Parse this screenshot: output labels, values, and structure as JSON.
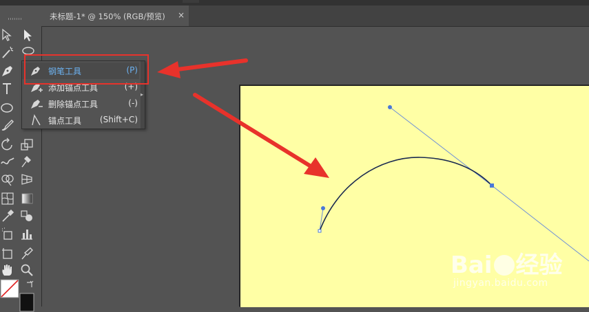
{
  "document_tab": {
    "title": "未标题-1* @ 150% (RGB/预览)",
    "close_glyph": "×"
  },
  "toolbar": {
    "tools": [
      {
        "name": "selection-tool-icon"
      },
      {
        "name": "direct-selection-tool-icon"
      },
      {
        "name": "magic-wand-tool-icon"
      },
      {
        "name": "lasso-tool-icon"
      },
      {
        "name": "pen-tool-icon"
      },
      {
        "name": "type-tool-icon"
      },
      {
        "name": "ellipse-tool-icon"
      },
      {
        "name": "paintbrush-tool-icon"
      },
      {
        "name": "rotate-tool-icon"
      },
      {
        "name": "scale-tool-icon"
      },
      {
        "name": "warp-tool-icon"
      },
      {
        "name": "puppet-warp-tool-icon"
      },
      {
        "name": "shape-builder-tool-icon"
      },
      {
        "name": "perspective-grid-tool-icon"
      },
      {
        "name": "mesh-tool-icon"
      },
      {
        "name": "gradient-tool-icon"
      },
      {
        "name": "eyedropper-tool-icon"
      },
      {
        "name": "blend-tool-icon"
      },
      {
        "name": "symbol-sprayer-tool-icon"
      },
      {
        "name": "column-graph-tool-icon"
      },
      {
        "name": "artboard-tool-icon"
      },
      {
        "name": "slice-tool-icon"
      },
      {
        "name": "hand-tool-icon"
      },
      {
        "name": "zoom-tool-icon"
      }
    ]
  },
  "pen_flyout": {
    "items": [
      {
        "label": "钢笔工具",
        "shortcut": "(P)",
        "icon": "pen-icon",
        "active": true
      },
      {
        "label": "添加锚点工具",
        "shortcut": "(+)",
        "icon": "add-anchor-point-icon",
        "active": false
      },
      {
        "label": "删除锚点工具",
        "shortcut": "(-)",
        "icon": "delete-anchor-point-icon",
        "active": false
      },
      {
        "label": "锚点工具",
        "shortcut": "(Shift+C)",
        "icon": "anchor-point-icon",
        "active": false
      }
    ]
  },
  "annotations": {
    "highlight_color": "#e8322b"
  },
  "canvas": {
    "artboard_color": "#ffffa5",
    "path_color": "#1a2a50",
    "handle_color": "#4a78d8"
  },
  "watermark": {
    "logo_left": "Bai",
    "logo_right": "经验",
    "url": "jingyan.baidu.com"
  }
}
